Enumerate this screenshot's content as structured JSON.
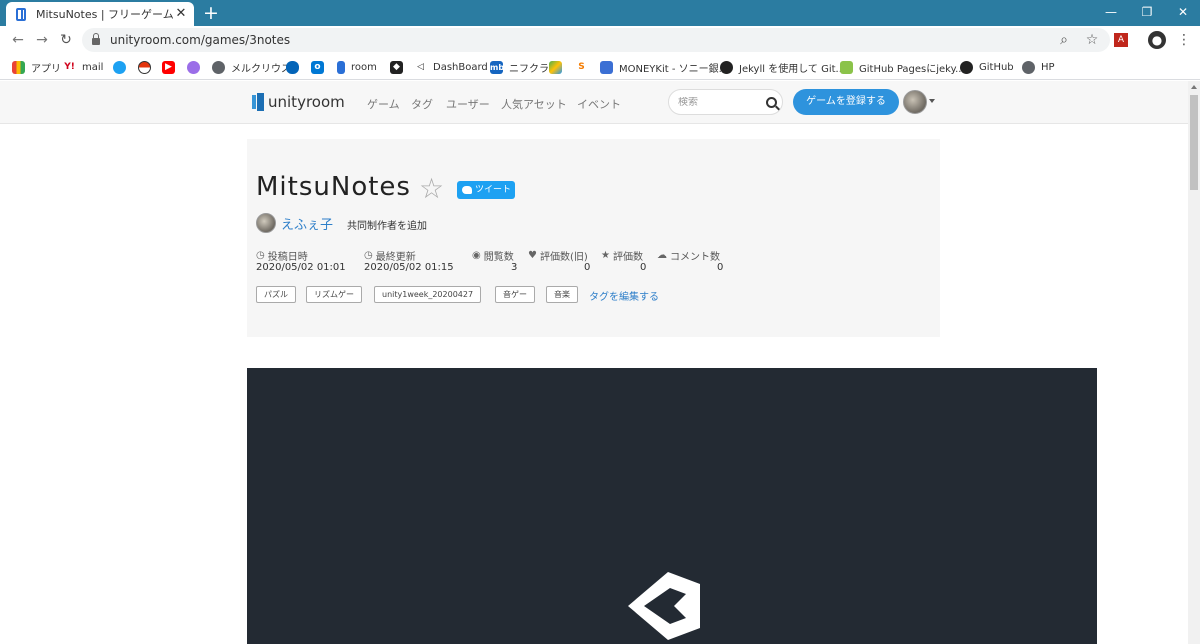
{
  "browser": {
    "tab_title": "MitsuNotes | フリーゲーム投稿サイト",
    "url": "unityroom.com/games/3notes",
    "bookmarks": [
      "アプリ",
      "mail",
      "メルクリウス",
      "room",
      "DashBoard",
      "ニフクラ",
      "MONEYKit - ソニー銀...",
      "Jekyll を使用して Git...",
      "GitHub Pagesにjeky...",
      "GitHub",
      "HP"
    ]
  },
  "site": {
    "logo": "unityroom",
    "nav": [
      "ゲーム",
      "タグ",
      "ユーザー",
      "人気アセット",
      "イベント"
    ],
    "search_placeholder": "検索",
    "register_button": "ゲームを登録する"
  },
  "game": {
    "title": "MitsuNotes",
    "tweet_label": "ツイート",
    "author": "えふぇ子",
    "add_coauthor": "共同制作者を追加",
    "stats": [
      {
        "label": "投稿日時",
        "value": "2020/05/02 01:01"
      },
      {
        "label": "最終更新",
        "value": "2020/05/02 01:15"
      },
      {
        "label": "閲覧数",
        "value": "3"
      },
      {
        "label": "評価数(旧)",
        "value": "0"
      },
      {
        "label": "評価数",
        "value": "0"
      },
      {
        "label": "コメント数",
        "value": "0"
      }
    ],
    "tags": [
      "パズル",
      "リズムゲー",
      "unity1week_20200427",
      "音ゲー",
      "音楽"
    ],
    "edit_tags": "タグを編集する"
  },
  "colors": {
    "chrome_tabstrip": "#2b7ca1",
    "accent": "#2e93dd",
    "link": "#2e7fc9",
    "player_bg": "#232a33"
  }
}
